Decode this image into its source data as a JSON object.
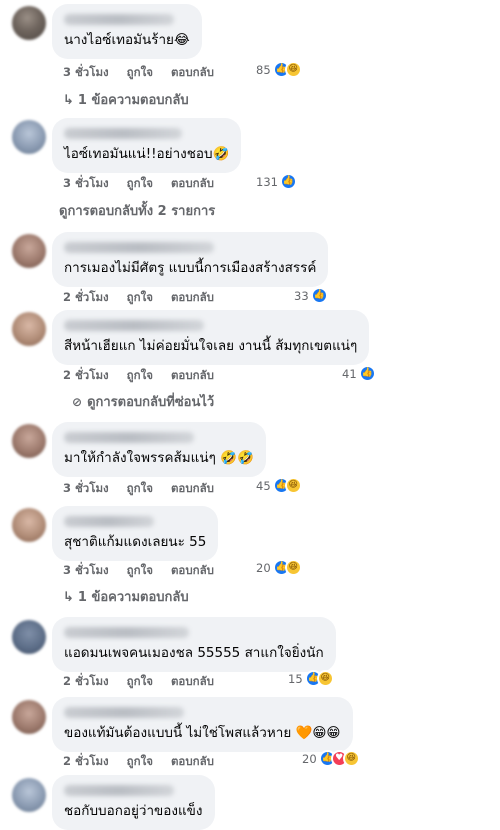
{
  "labels": {
    "like": "ถูกใจ",
    "reply": "ตอบกลับ"
  },
  "comments": [
    {
      "text": "นางไอซ์เทอมันร้าย😂",
      "time": "3 ชั่วโมง",
      "count": "85",
      "reactions": [
        "like",
        "haha"
      ],
      "more": "1 ข้อความตอบกลับ",
      "more_type": "arrow"
    },
    {
      "text": "ไอซ์เทอมันแน่!!อย่างชอบ🤣",
      "time": "3 ชั่วโมง",
      "count": "131",
      "reactions": [
        "like"
      ],
      "more": "ดูการตอบกลับทั้ง 2 รายการ",
      "more_type": "plain"
    },
    {
      "text": "การเมองไม่มีศัตรู แบบนี้การเมืองสร้างสรรค์",
      "time": "2 ชั่วโมง",
      "count": "33",
      "reactions": [
        "like"
      ]
    },
    {
      "text": "สีหน้าเฮียแก ไม่ค่อยมั่นใจเลย งานนี้ ส้มทุกเขตแน่ๆ",
      "time": "2 ชั่วโมง",
      "count": "41",
      "reactions": [
        "like"
      ],
      "more": "ดูการตอบกลับที่ซ่อนไว้",
      "more_type": "hidden"
    },
    {
      "text": "มาให้กำลังใจพรรคส้มแน่ๆ 🤣🤣",
      "time": "3 ชั่วโมง",
      "count": "45",
      "reactions": [
        "like",
        "haha"
      ]
    },
    {
      "text": "สุชาติแก้มแดงเลยนะ 55",
      "time": "3 ชั่วโมง",
      "count": "20",
      "reactions": [
        "like",
        "haha"
      ],
      "more": "1 ข้อความตอบกลับ",
      "more_type": "arrow"
    },
    {
      "text": "แอดมนเพจคนเมองชล 55555 สาแกใจยิ่งนัก",
      "time": "2 ชั่วโมง",
      "count": "15",
      "reactions": [
        "like",
        "haha"
      ]
    },
    {
      "text": "ของแท้มันต้องแบบนี้ ไม่ใช่โพสแล้วหาย 🧡😁😁",
      "time": "2 ชั่วโมง",
      "count": "20",
      "reactions": [
        "like",
        "love",
        "haha"
      ]
    },
    {
      "text": "ชอกับบอกอยู่ว่าของแข็ง"
    }
  ]
}
